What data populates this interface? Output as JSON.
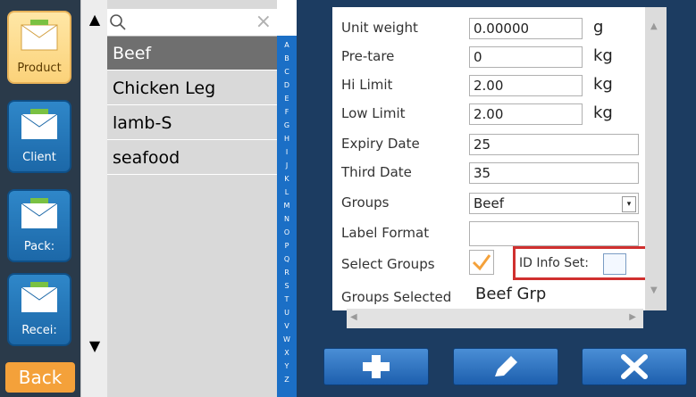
{
  "sidebar": {
    "items": [
      {
        "label": "Product",
        "icon": "product-icon"
      },
      {
        "label": "Client",
        "icon": "client-icon"
      },
      {
        "label": "Pack:",
        "icon": "pack-icon"
      },
      {
        "label": "Recei:",
        "icon": "receive-icon"
      }
    ],
    "back_label": "Back"
  },
  "search": {
    "value": "",
    "clear_icon": "×"
  },
  "list": {
    "items": [
      "Beef",
      "Chicken Leg",
      "lamb-S",
      "seafood"
    ],
    "selected": "Beef"
  },
  "alpha_index": [
    "A",
    "B",
    "C",
    "D",
    "E",
    "F",
    "G",
    "H",
    "I",
    "J",
    "K",
    "L",
    "M",
    "N",
    "O",
    "P",
    "Q",
    "R",
    "S",
    "T",
    "U",
    "V",
    "W",
    "X",
    "Y",
    "Z"
  ],
  "form": {
    "unit_weight": {
      "label": "Unit weight",
      "value": "0.00000",
      "unit": "g"
    },
    "pre_tare": {
      "label": "Pre-tare",
      "value": "0",
      "unit": "kg"
    },
    "hi_limit": {
      "label": "Hi Limit",
      "value": "2.00",
      "unit": "kg"
    },
    "low_limit": {
      "label": "Low Limit",
      "value": "2.00",
      "unit": "kg"
    },
    "expiry_date": {
      "label": "Expiry Date",
      "value": "25"
    },
    "third_date": {
      "label": "Third Date",
      "value": "35"
    },
    "groups": {
      "label": "Groups",
      "value": "Beef"
    },
    "label_format": {
      "label": "Label Format",
      "value": ""
    },
    "select_groups": {
      "label": "Select Groups",
      "checked": true
    },
    "id_info_set": {
      "label": "ID Info Set:",
      "checked": false
    },
    "groups_selected": {
      "label": "Groups Selected",
      "value": "Beef Grp"
    }
  },
  "toolbar": {
    "add_icon": "add-icon",
    "edit_icon": "pencil-icon",
    "delete_icon": "close-icon"
  },
  "colors": {
    "highlight": "#d0302f",
    "accent": "#f4a13a",
    "alpha_bar": "#1b6fc6",
    "panel_bg": "#1c3c61"
  }
}
